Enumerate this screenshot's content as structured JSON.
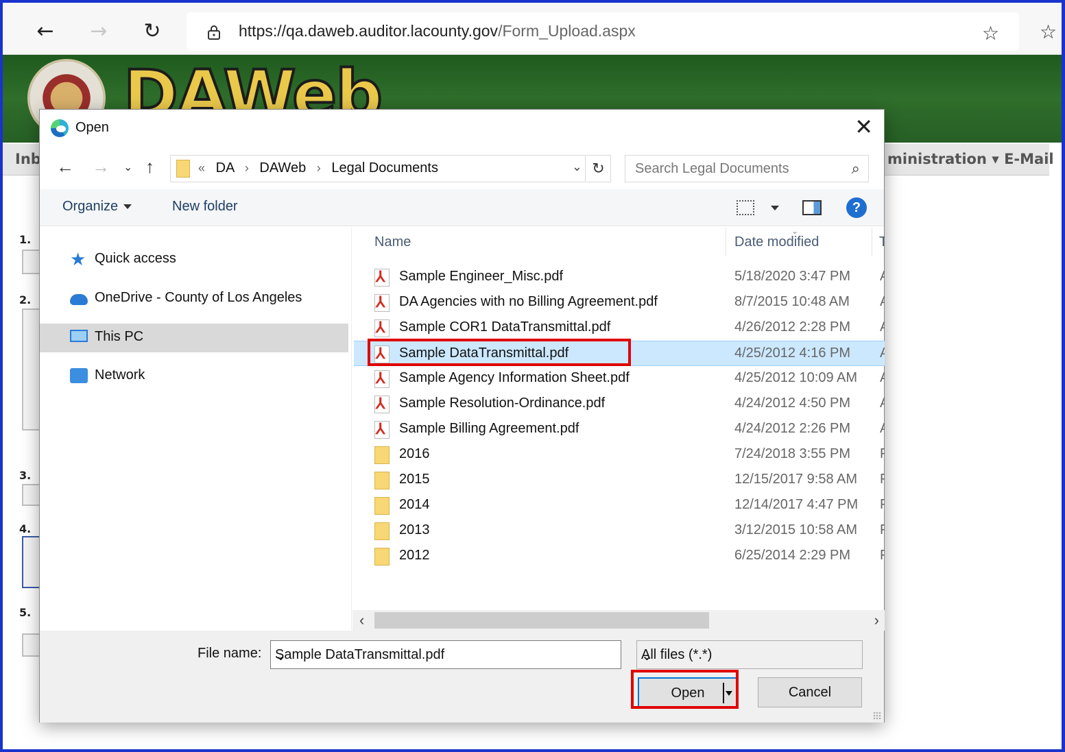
{
  "browser": {
    "url_main": "https://qa.daweb.auditor.lacounty.gov",
    "url_path": "/Form_Upload.aspx"
  },
  "site": {
    "logo_text": "DAWeb",
    "menu_left": "Inb",
    "menu_right": "ministration ▾ E-Mail",
    "steps": [
      "1.",
      "2.",
      "3.",
      "4.",
      "5."
    ]
  },
  "dialog": {
    "title": "Open",
    "breadcrumb": [
      "DA",
      "DAWeb",
      "Legal Documents"
    ],
    "search_placeholder": "Search Legal Documents",
    "toolbar": {
      "organize": "Organize",
      "new_folder": "New folder"
    },
    "nav_items": [
      {
        "label": "Quick access",
        "icon": "quick-access-star-icon"
      },
      {
        "label": "OneDrive - County of Los Angeles",
        "icon": "onedrive-cloud-icon"
      },
      {
        "label": "This PC",
        "icon": "this-pc-monitor-icon",
        "selected": true
      },
      {
        "label": "Network",
        "icon": "network-icon"
      }
    ],
    "columns": {
      "name": "Name",
      "date": "Date modified"
    },
    "files": [
      {
        "name": "Sample Engineer_Misc.pdf",
        "date": "5/18/2020 3:47 PM",
        "kind": "pdf",
        "type_initial": "A"
      },
      {
        "name": "DA Agencies with no Billing Agreement.pdf",
        "date": "8/7/2015 10:48 AM",
        "kind": "pdf",
        "type_initial": "A"
      },
      {
        "name": "Sample COR1 DataTransmittal.pdf",
        "date": "4/26/2012 2:28 PM",
        "kind": "pdf",
        "type_initial": "A"
      },
      {
        "name": "Sample DataTransmittal.pdf",
        "date": "4/25/2012 4:16 PM",
        "kind": "pdf",
        "type_initial": "A",
        "selected": true
      },
      {
        "name": "Sample Agency Information Sheet.pdf",
        "date": "4/25/2012 10:09 AM",
        "kind": "pdf",
        "type_initial": "A"
      },
      {
        "name": "Sample Resolution-Ordinance.pdf",
        "date": "4/24/2012 4:50 PM",
        "kind": "pdf",
        "type_initial": "A"
      },
      {
        "name": "Sample Billing Agreement.pdf",
        "date": "4/24/2012 2:26 PM",
        "kind": "pdf",
        "type_initial": "A"
      },
      {
        "name": "2016",
        "date": "7/24/2018 3:55 PM",
        "kind": "folder",
        "type_initial": "F"
      },
      {
        "name": "2015",
        "date": "12/15/2017 9:58 AM",
        "kind": "folder",
        "type_initial": "F"
      },
      {
        "name": "2014",
        "date": "12/14/2017 4:47 PM",
        "kind": "folder",
        "type_initial": "F"
      },
      {
        "name": "2013",
        "date": "3/12/2015 10:58 AM",
        "kind": "folder",
        "type_initial": "F"
      },
      {
        "name": "2012",
        "date": "6/25/2014 2:29 PM",
        "kind": "folder",
        "type_initial": "F"
      }
    ],
    "file_name_label": "File name:",
    "file_name_value": "Sample DataTransmittal.pdf",
    "file_type": "All files (*.*)",
    "open_label": "Open",
    "cancel_label": "Cancel"
  },
  "colors": {
    "highlight": "#e00000",
    "selection": "#cce8ff",
    "header_green": "#2f6e2b",
    "frame_blue": "#1a33cc"
  }
}
